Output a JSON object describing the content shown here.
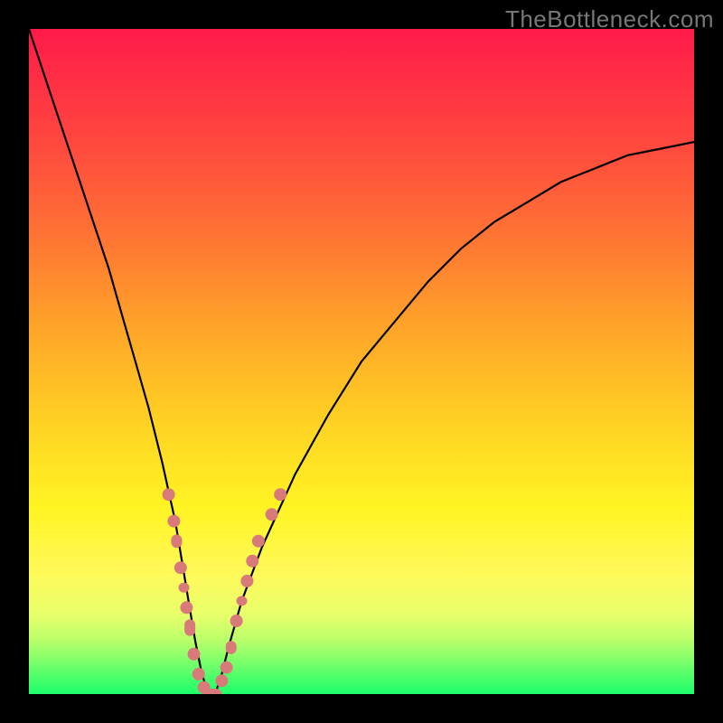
{
  "watermark": "TheBottleneck.com",
  "colors": {
    "gradient_top": "#ff1a4a",
    "gradient_bottom": "#1aff6a",
    "curve": "#000000",
    "dots": "#d97a7a",
    "frame": "#000000"
  },
  "chart_data": {
    "type": "line",
    "title": "",
    "xlabel": "",
    "ylabel": "",
    "xlim": [
      0,
      100
    ],
    "ylim": [
      0,
      100
    ],
    "grid": false,
    "legend": false,
    "series": [
      {
        "name": "bottleneck-curve",
        "x": [
          0,
          4,
          8,
          12,
          14,
          16,
          18,
          20,
          22,
          23,
          24,
          25,
          26,
          27,
          28,
          29,
          30,
          32,
          35,
          40,
          45,
          50,
          55,
          60,
          65,
          70,
          75,
          80,
          85,
          90,
          95,
          100
        ],
        "y": [
          100,
          88,
          76,
          64,
          57,
          50,
          43,
          35,
          26,
          20,
          14,
          8,
          3,
          0,
          0,
          3,
          7,
          14,
          22,
          33,
          42,
          50,
          56,
          62,
          67,
          71,
          74,
          77,
          79,
          81,
          82,
          83
        ]
      }
    ],
    "markers": [
      {
        "x": 21.0,
        "y": 30,
        "kind": "dot"
      },
      {
        "x": 21.8,
        "y": 26,
        "kind": "dot"
      },
      {
        "x": 22.2,
        "y": 23,
        "kind": "pill",
        "len": 4
      },
      {
        "x": 22.8,
        "y": 19,
        "kind": "dot"
      },
      {
        "x": 23.3,
        "y": 16,
        "kind": "pill",
        "len": 3
      },
      {
        "x": 23.7,
        "y": 13,
        "kind": "dot"
      },
      {
        "x": 24.2,
        "y": 10,
        "kind": "pill",
        "len": 5
      },
      {
        "x": 24.8,
        "y": 6,
        "kind": "dot"
      },
      {
        "x": 25.5,
        "y": 3,
        "kind": "dot"
      },
      {
        "x": 26.3,
        "y": 1,
        "kind": "dot"
      },
      {
        "x": 27.5,
        "y": 0,
        "kind": "pill",
        "len": 6,
        "orient": "h"
      },
      {
        "x": 29.0,
        "y": 2,
        "kind": "dot"
      },
      {
        "x": 29.7,
        "y": 4,
        "kind": "dot"
      },
      {
        "x": 30.4,
        "y": 7,
        "kind": "pill",
        "len": 4
      },
      {
        "x": 31.2,
        "y": 11,
        "kind": "dot"
      },
      {
        "x": 32.0,
        "y": 14,
        "kind": "pill",
        "len": 3
      },
      {
        "x": 32.8,
        "y": 17,
        "kind": "dot"
      },
      {
        "x": 33.6,
        "y": 20,
        "kind": "dot"
      },
      {
        "x": 34.5,
        "y": 23,
        "kind": "dot"
      },
      {
        "x": 36.5,
        "y": 27,
        "kind": "dot"
      },
      {
        "x": 37.8,
        "y": 30,
        "kind": "dot"
      }
    ]
  }
}
